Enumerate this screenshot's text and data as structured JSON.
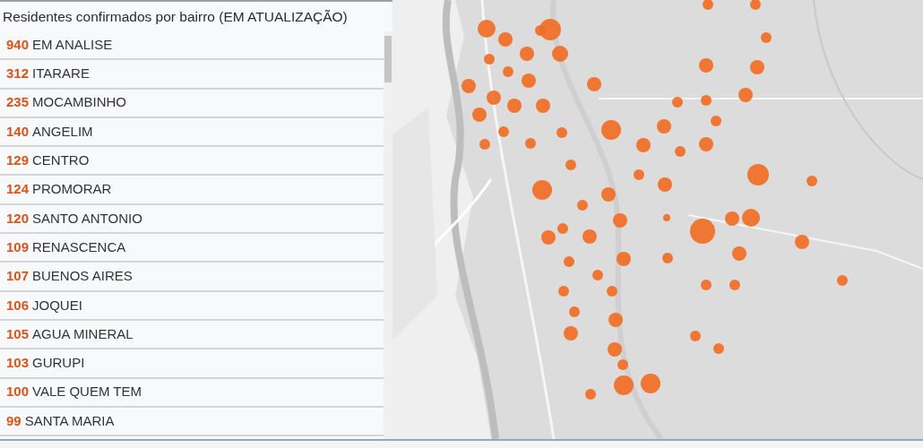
{
  "list": {
    "title": "Residentes confirmados por bairro (EM ATUALIZAÇÃO)",
    "items": [
      {
        "count": "940",
        "name": "EM ANALISE"
      },
      {
        "count": "312",
        "name": "ITARARE"
      },
      {
        "count": "235",
        "name": "MOCAMBINHO"
      },
      {
        "count": "140",
        "name": "ANGELIM"
      },
      {
        "count": "129",
        "name": "CENTRO"
      },
      {
        "count": "124",
        "name": "PROMORAR"
      },
      {
        "count": "120",
        "name": "SANTO ANTONIO"
      },
      {
        "count": "109",
        "name": "RENASCENCA"
      },
      {
        "count": "107",
        "name": "BUENOS AIRES"
      },
      {
        "count": "106",
        "name": "JOQUEI"
      },
      {
        "count": "105",
        "name": "AGUA MINERAL"
      },
      {
        "count": "103",
        "name": "GURUPI"
      },
      {
        "count": "100",
        "name": "VALE QUEM TEM"
      },
      {
        "count": "99",
        "name": "SANTA MARIA"
      }
    ]
  }
}
